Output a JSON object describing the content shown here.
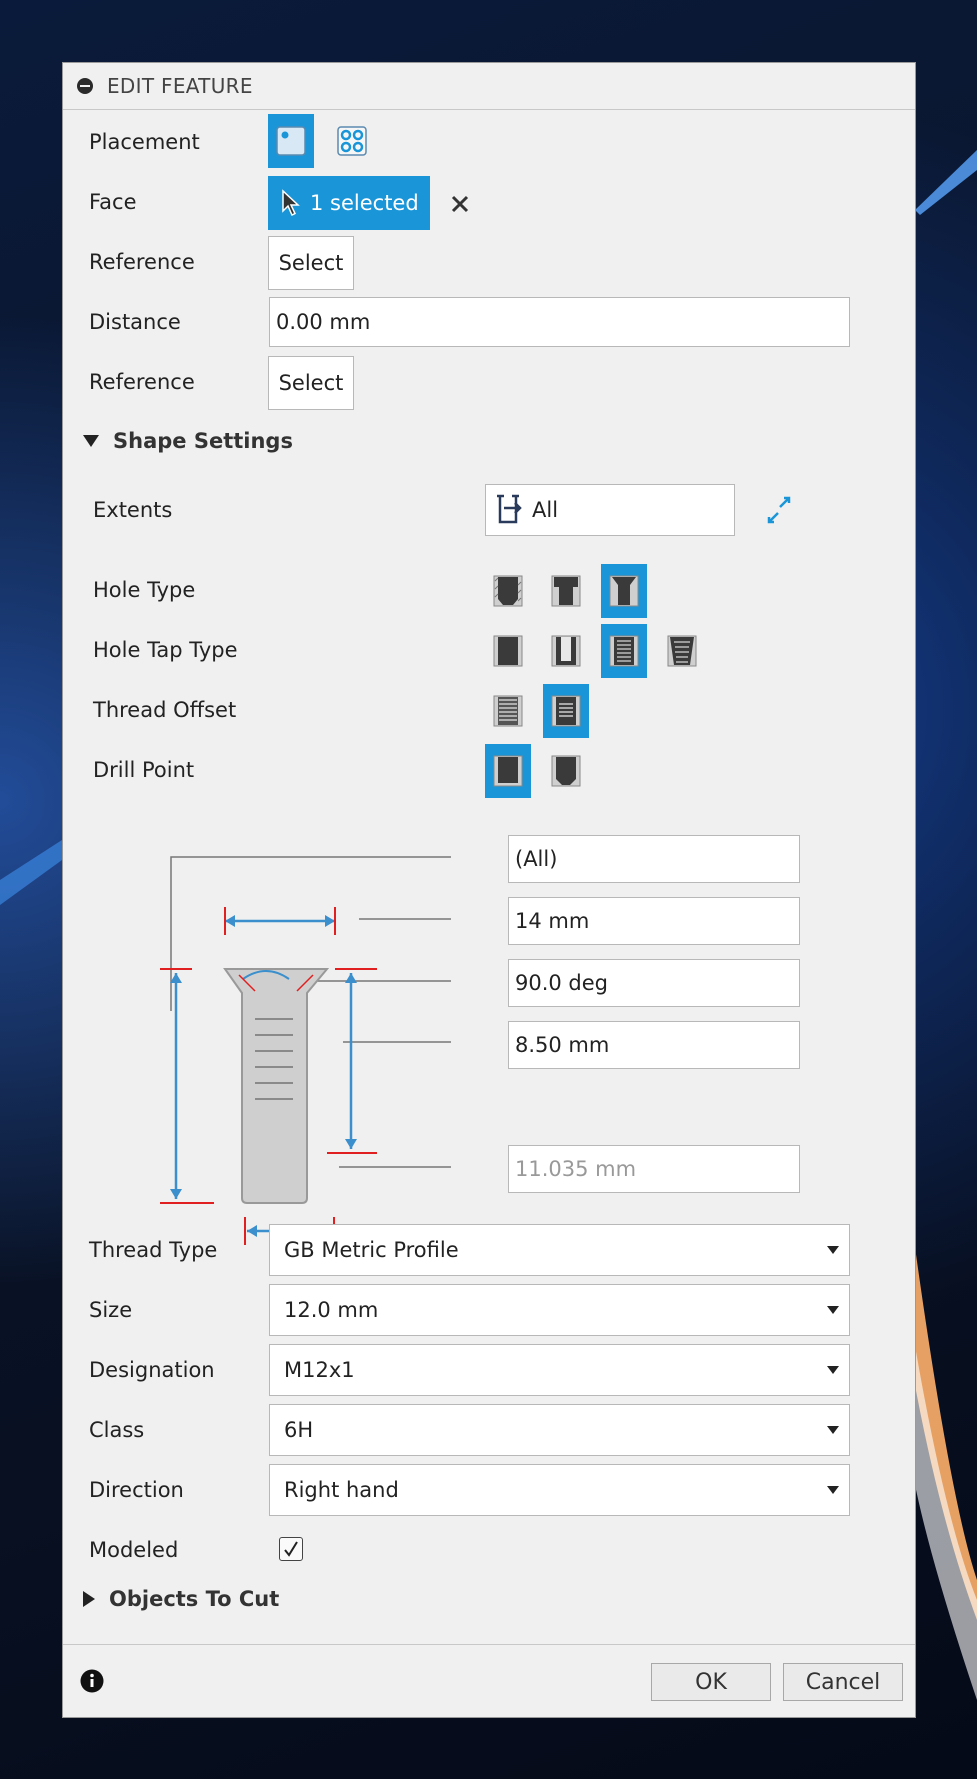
{
  "dialog": {
    "title": "EDIT FEATURE"
  },
  "placement": {
    "label": "Placement"
  },
  "face": {
    "label": "Face",
    "selection": "1 selected",
    "clear_icon": "close-icon"
  },
  "reference1": {
    "label": "Reference",
    "button": "Select"
  },
  "distance": {
    "label": "Distance",
    "value": "0.00 mm"
  },
  "reference2": {
    "label": "Reference",
    "button": "Select"
  },
  "shape_settings": {
    "label": "Shape Settings"
  },
  "extents": {
    "label": "Extents",
    "value": "All"
  },
  "hole_type": {
    "label": "Hole Type"
  },
  "hole_tap_type": {
    "label": "Hole Tap Type"
  },
  "thread_offset": {
    "label": "Thread Offset"
  },
  "drill_point": {
    "label": "Drill Point"
  },
  "dimensions": {
    "extent": "(All)",
    "countersink_diameter": "14 mm",
    "countersink_angle": "90.0 deg",
    "depth": "8.50 mm",
    "hole_diameter": "11.035 mm"
  },
  "thread_type": {
    "label": "Thread Type",
    "value": "GB Metric Profile"
  },
  "size": {
    "label": "Size",
    "value": "12.0 mm"
  },
  "designation": {
    "label": "Designation",
    "value": "M12x1"
  },
  "class": {
    "label": "Class",
    "value": "6H"
  },
  "direction": {
    "label": "Direction",
    "value": "Right hand"
  },
  "modeled": {
    "label": "Modeled",
    "checked": true
  },
  "objects_to_cut": {
    "label": "Objects To Cut"
  },
  "footer": {
    "ok": "OK",
    "cancel": "Cancel"
  },
  "colors": {
    "accent": "#1a96d8",
    "dimension_line": "#3a8fcc",
    "dimension_tick": "#e02020"
  }
}
